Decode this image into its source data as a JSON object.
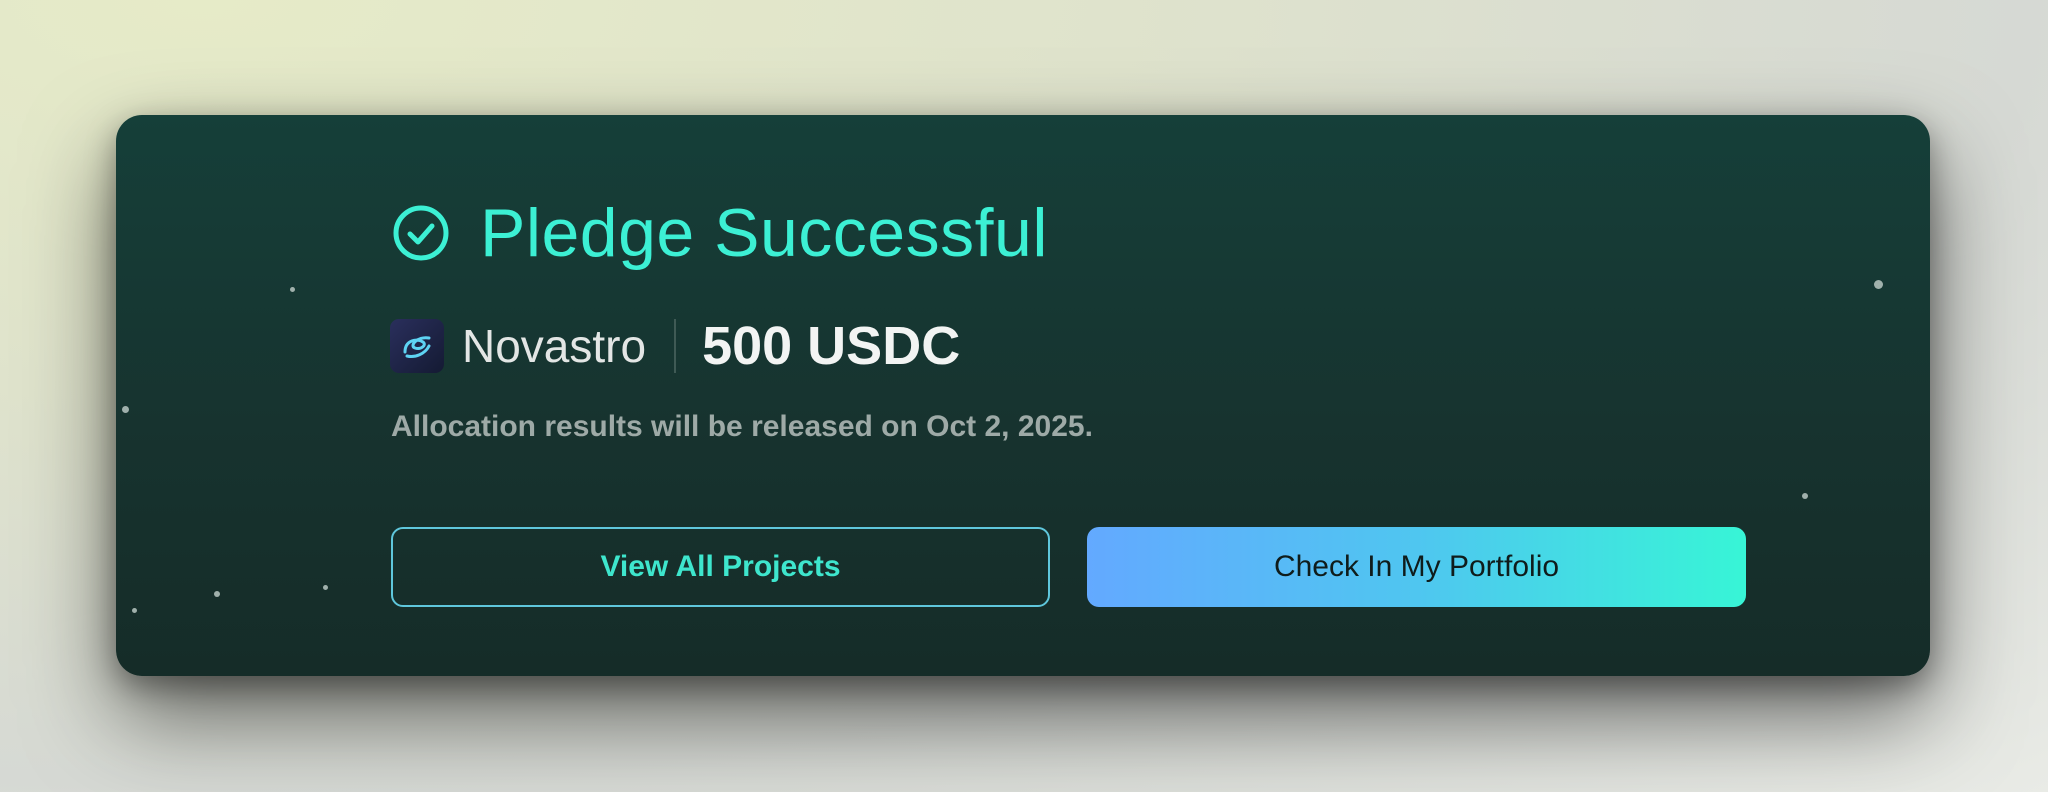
{
  "card": {
    "title": "Pledge Successful",
    "project": {
      "name": "Novastro",
      "amount": "500 USDC",
      "logo_icon": "novastro-logo-icon"
    },
    "note": "Allocation results will be released on Oct 2, 2025.",
    "buttons": {
      "secondary_label": "View All Projects",
      "primary_label": "Check In My Portfolio"
    }
  },
  "colors": {
    "accent": "#3cf0d4",
    "card_background": "#17332f",
    "primary_gradient_start": "#63a9ff",
    "primary_gradient_end": "#37f5d6"
  },
  "icons": {
    "success": "check-circle-icon"
  }
}
